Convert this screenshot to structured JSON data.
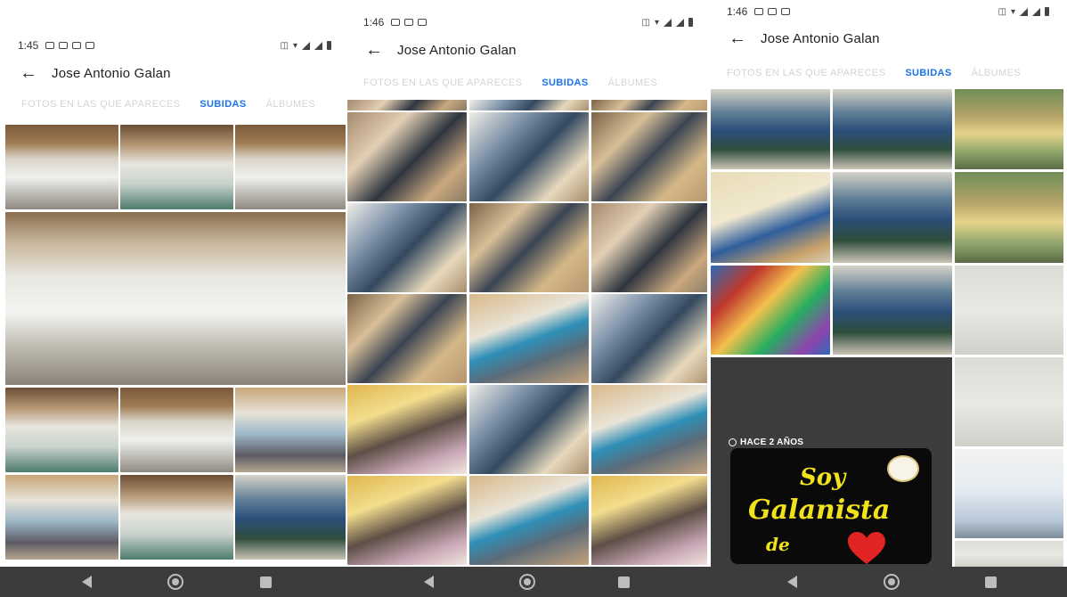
{
  "screens": [
    {
      "status_time": "1:45",
      "title": "Jose Antonio Galan",
      "tabs": [
        {
          "label": "FOTOS EN LAS QUE APARECES",
          "active": false
        },
        {
          "label": "SUBIDAS",
          "active": true
        },
        {
          "label": "ÁLBUMES",
          "active": false
        }
      ]
    },
    {
      "status_time": "1:46",
      "title": "Jose Antonio Galan",
      "tabs": [
        {
          "label": "FOTOS EN LAS QUE APARECES",
          "active": false
        },
        {
          "label": "SUBIDAS",
          "active": true
        },
        {
          "label": "ÁLBUMES",
          "active": false
        }
      ]
    },
    {
      "status_time": "1:46",
      "title": "Jose Antonio Galan",
      "tabs": [
        {
          "label": "FOTOS EN LAS QUE APARECES",
          "active": false
        },
        {
          "label": "SUBIDAS",
          "active": true
        },
        {
          "label": "ÁLBUMES",
          "active": false
        }
      ],
      "album_badge": "HACE 2 AÑOS",
      "album_card": {
        "line1": "Soy",
        "line2": "Galanista",
        "line3": "de"
      }
    }
  ],
  "status_icons": [
    "vibrate-icon",
    "lte-icon",
    "wifi-icon",
    "signal-icon",
    "battery-icon"
  ],
  "nav_icons": [
    "nav-back-icon",
    "nav-home-icon",
    "nav-recent-icon"
  ],
  "colors": {
    "accent": "#1a73e8",
    "tab_inactive": "#d4d4d4",
    "navbar": "#3c3c3c",
    "card_text": "#f2e21c"
  }
}
